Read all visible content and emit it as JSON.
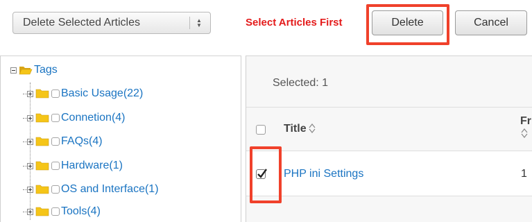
{
  "toolbar": {
    "action_select": {
      "value": "Delete Selected Articles"
    },
    "warning": "Select Articles First",
    "delete_label": "Delete",
    "cancel_label": "Cancel"
  },
  "tree": {
    "root": {
      "label": "Tags",
      "icon": "folder-open-icon",
      "expanded": true
    },
    "items": [
      {
        "label": "Basic Usage(22)",
        "checked": false
      },
      {
        "label": "Connetion(4)",
        "checked": false
      },
      {
        "label": "FAQs(4)",
        "checked": false
      },
      {
        "label": "Hardware(1)",
        "checked": false
      },
      {
        "label": "OS and Interface(1)",
        "checked": false
      },
      {
        "label": "Tools(4)",
        "checked": false
      }
    ]
  },
  "articles": {
    "selected_text": "Selected: 1",
    "columns": [
      {
        "label": "Title",
        "sortable": true
      },
      {
        "label": "Fr",
        "sortable": true
      }
    ],
    "rows": [
      {
        "title": "PHP ini Settings",
        "fr": "1",
        "checked": true
      }
    ]
  },
  "colors": {
    "link": "#1a74c2",
    "warning": "#e41b1b",
    "highlight": "#f0412b",
    "folder": "#f5c518"
  }
}
